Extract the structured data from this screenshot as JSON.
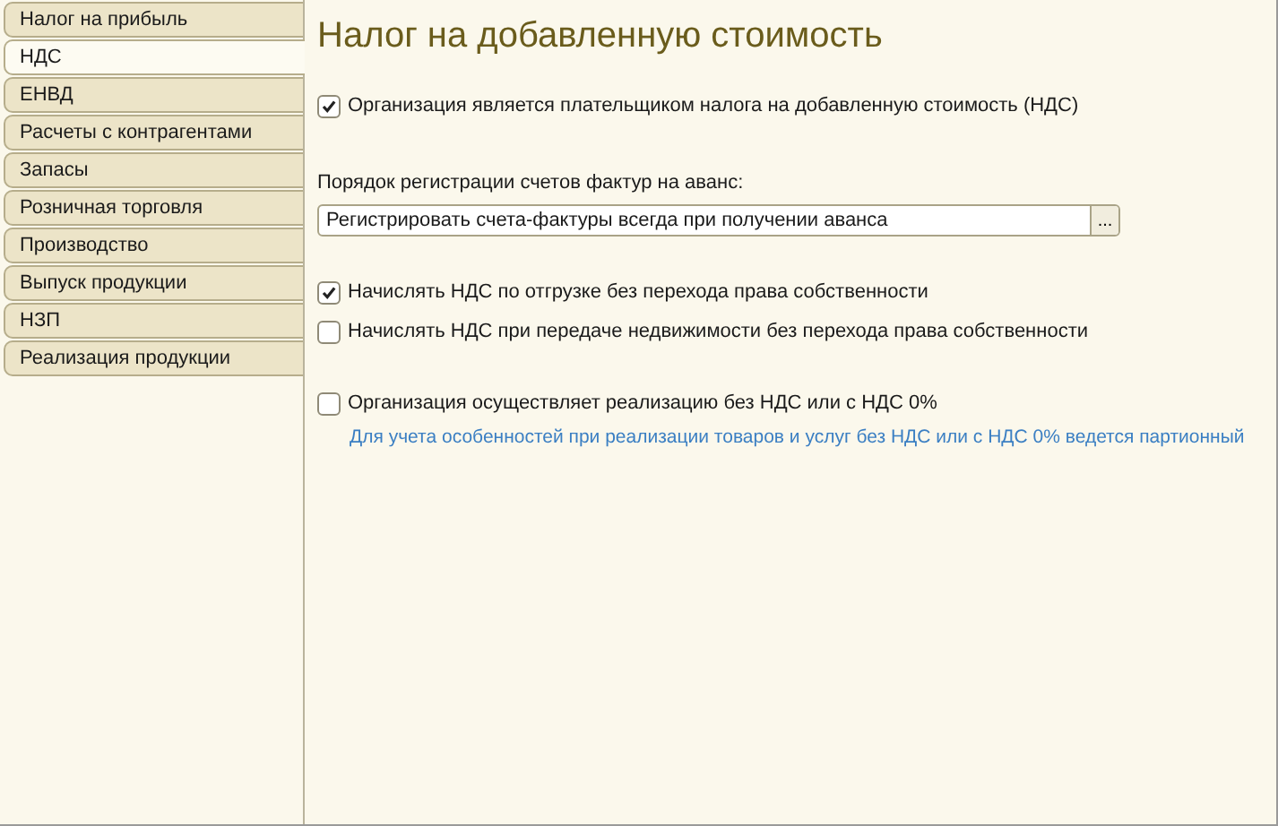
{
  "tabs": [
    {
      "label": "Налог на прибыль",
      "selected": false
    },
    {
      "label": "НДС",
      "selected": true
    },
    {
      "label": "ЕНВД",
      "selected": false
    },
    {
      "label": "Расчеты с контрагентами",
      "selected": false
    },
    {
      "label": "Запасы",
      "selected": false
    },
    {
      "label": "Розничная торговля",
      "selected": false
    },
    {
      "label": "Производство",
      "selected": false
    },
    {
      "label": "Выпуск продукции",
      "selected": false
    },
    {
      "label": "НЗП",
      "selected": false
    },
    {
      "label": "Реализация продукции",
      "selected": false
    }
  ],
  "title": "Налог на добавленную стоимость",
  "vat_payer": {
    "label": "Организация является плательщиком налога на добавленную стоимость (НДС)",
    "checked": true
  },
  "invoice_order": {
    "label": "Порядок регистрации счетов фактур на аванс:",
    "value": "Регистрировать счета-фактуры всегда при получении аванса",
    "button": "..."
  },
  "options": [
    {
      "label": "Начислять НДС по отгрузке без перехода права собственности",
      "checked": true
    },
    {
      "label": "Начислять НДС при передаче недвижимости без перехода права собственности",
      "checked": false
    }
  ],
  "zero_vat": {
    "label": "Организация осуществляет реализацию без НДС или с НДС 0%",
    "checked": false,
    "hint": "Для учета особенностей при реализации товаров и услуг без НДС или с НДС 0% ведется партионный"
  }
}
